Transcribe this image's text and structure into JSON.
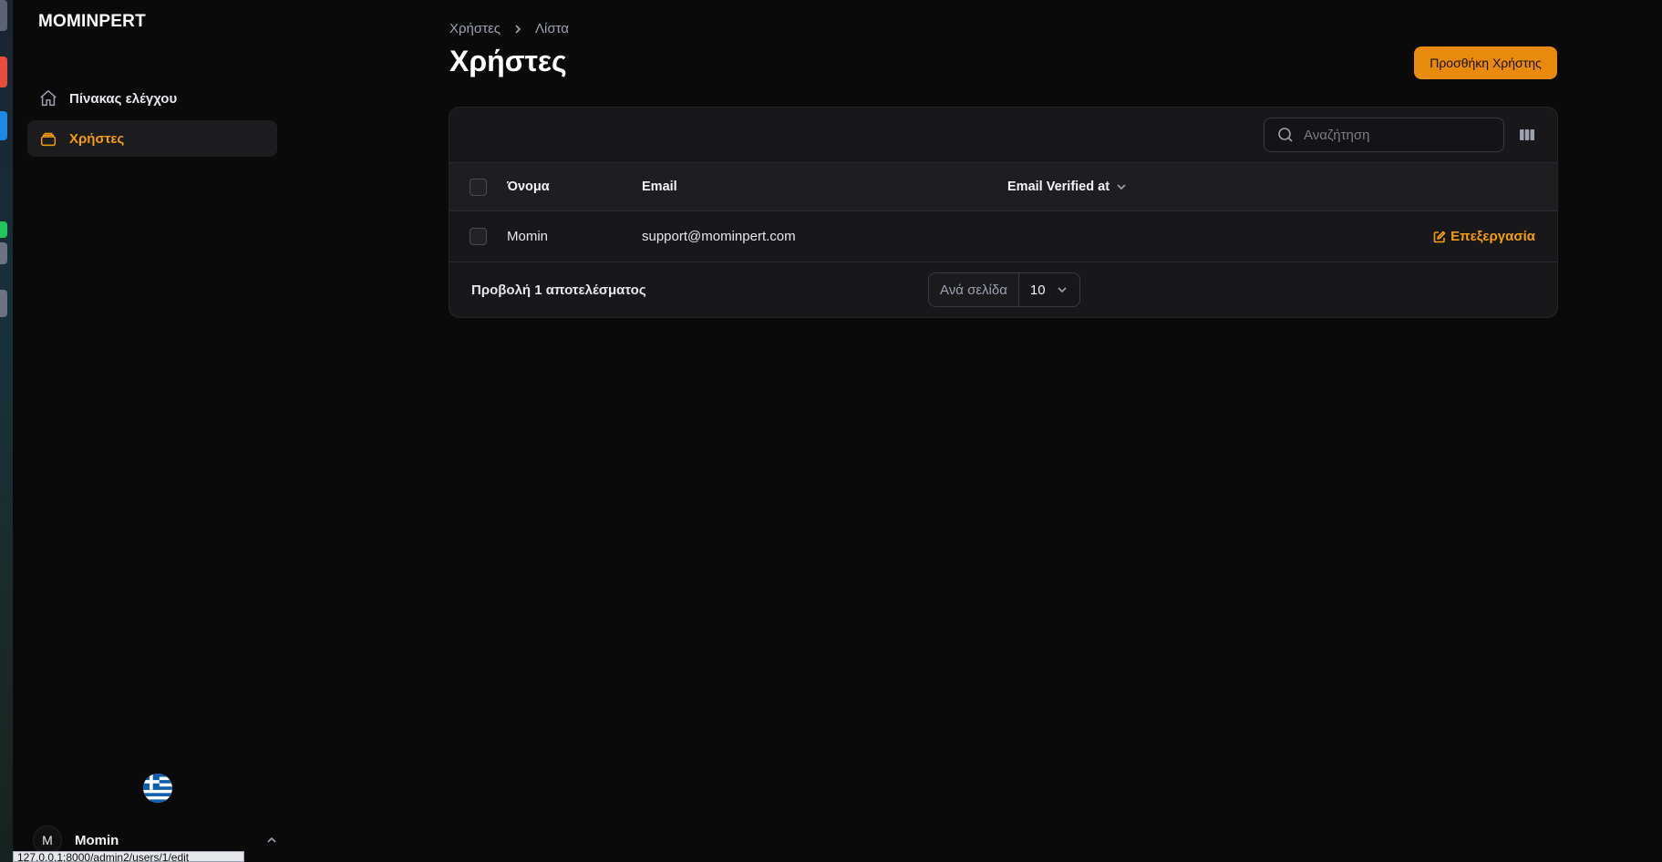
{
  "app": {
    "brand": "MOMINPERT"
  },
  "sidebar": {
    "items": [
      {
        "label": "Πίνακας ελέγχου",
        "icon": "home-icon",
        "active": false
      },
      {
        "label": "Χρήστες",
        "icon": "users-stack-icon",
        "active": true
      }
    ],
    "user": {
      "initial": "M",
      "name": "Momin"
    },
    "locale_icon": "greece-flag-icon"
  },
  "breadcrumb": {
    "items": [
      "Χρήστες",
      "Λίστα"
    ]
  },
  "header": {
    "title": "Χρήστες",
    "add_button_label": "Προσθήκη Χρήστης"
  },
  "table": {
    "search_placeholder": "Αναζήτηση",
    "columns": [
      "Όνομα",
      "Email",
      "Email Verified at"
    ],
    "rows": [
      {
        "name": "Momin",
        "email": "support@mominpert.com",
        "verified_at": "",
        "action_label": "Επεξεργασία"
      }
    ],
    "footer": {
      "results_text": "Προβολή 1 αποτελέσματος",
      "per_page_label": "Ανά σελίδα",
      "per_page_value": "10"
    }
  },
  "statusbar": {
    "url": "127.0.0.1:8000/admin2/users/1/edit"
  },
  "colors": {
    "accent": "#f59e0b",
    "button": "#e88a0c",
    "background": "#0a0a0b",
    "card": "#18181b"
  }
}
